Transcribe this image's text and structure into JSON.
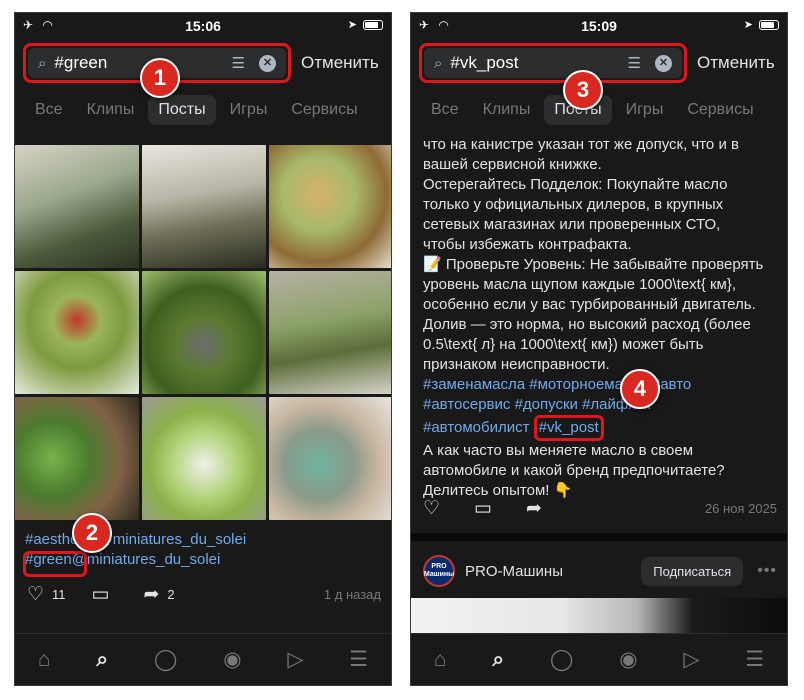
{
  "left": {
    "status": {
      "time": "15:06"
    },
    "search": {
      "query": "#green"
    },
    "cancel": "Отменить",
    "tabs": [
      "Все",
      "Клипы",
      "Посты",
      "Игры",
      "Сервисы"
    ],
    "active_tab": "Посты",
    "caption": {
      "line1": "#aesthetic @miniatures_du_solei",
      "line2": "#green@miniatures_du_solei"
    },
    "likes": "11",
    "reposts": "2",
    "time_ago": "1 д назад",
    "marker1": "1",
    "marker2": "2"
  },
  "right": {
    "status": {
      "time": "15:09"
    },
    "search": {
      "query": "#vk_post"
    },
    "cancel": "Отменить",
    "tabs": [
      "Все",
      "Клипы",
      "Посты",
      "Игры",
      "Сервисы"
    ],
    "active_tab": "Посты",
    "post_lines": [
      "что на канистре указан тот же допуск, что и в",
      "вашей сервисной книжке.",
      "Остерегайтесь Подделок: Покупайте масло",
      "только у официальных дилеров, в крупных",
      "сетевых магазинах или проверенных СТО,",
      "чтобы избежать контрафакта.",
      "📝 Проверьте Уровень: Не забывайте проверять",
      "уровень масла щупом каждые 1000\\text{ км},",
      "особенно если у вас турбированный двигатель.",
      "Долив — это норма, но высокий расход (более",
      "0.5\\text{ л} на 1000\\text{ км}) может быть",
      "признаком неисправности."
    ],
    "tags_line1": "#заменамасла #моторноемасло #авто",
    "tags_line2": "#автосервис #допуски #лайфхак",
    "tags_line3_prefix": "#автомобилист",
    "highlight_tag": "#vk_post",
    "outro_line1": "А как часто вы меняете масло в своем",
    "outro_line2": "автомобиле и какой бренд предпочитаете?",
    "outro_line3": "Делитесь опытом! 👇",
    "date": "26 ноя 2025",
    "author": {
      "name": "PRO-Машины",
      "avatar_text": "PRO\nМашины"
    },
    "subscribe": "Подписаться",
    "marker3": "3",
    "marker4": "4"
  }
}
